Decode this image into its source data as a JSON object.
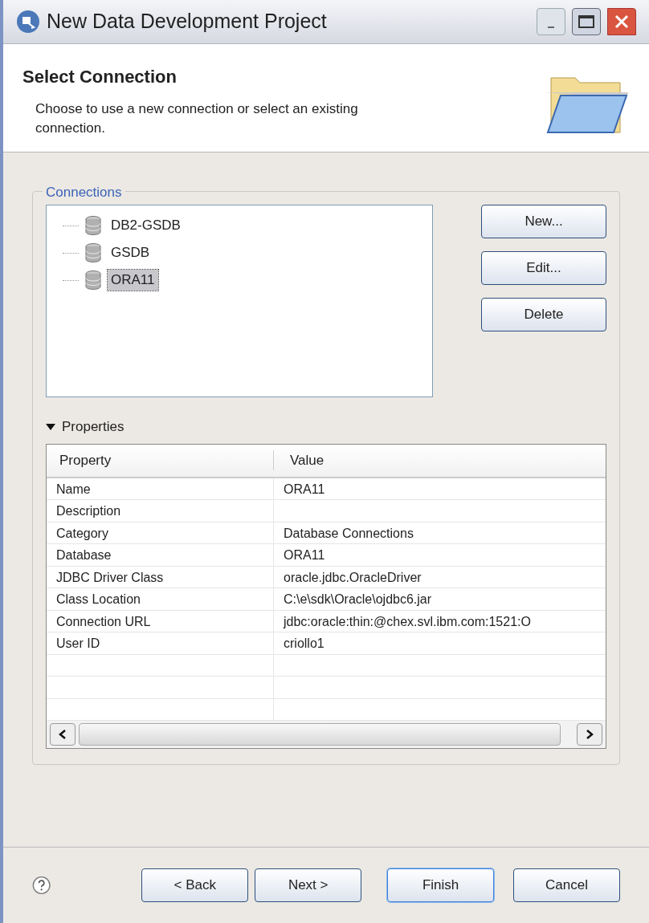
{
  "window": {
    "title": "New Data Development Project"
  },
  "header": {
    "title": "Select Connection",
    "description": "Choose to use a new connection or select an existing connection."
  },
  "connections": {
    "label": "Connections",
    "items": [
      {
        "label": "DB2-GSDB",
        "selected": false
      },
      {
        "label": "GSDB",
        "selected": false
      },
      {
        "label": "ORA11",
        "selected": true
      }
    ],
    "buttons": [
      "New...",
      "Edit...",
      "Delete"
    ]
  },
  "properties": {
    "label": "Properties",
    "expanded": true,
    "columns": [
      "Property",
      "Value"
    ],
    "rows": [
      [
        "Name",
        "ORA11"
      ],
      [
        "Description",
        ""
      ],
      [
        "Category",
        "Database Connections"
      ],
      [
        "Database",
        "ORA11"
      ],
      [
        "JDBC Driver Class",
        "oracle.jdbc.OracleDriver"
      ],
      [
        "Class Location",
        "C:\\e\\sdk\\Oracle\\ojdbc6.jar"
      ],
      [
        "Connection URL",
        "jdbc:oracle:thin:@chex.svl.ibm.com:1521:O"
      ],
      [
        "User ID",
        "criollo1"
      ]
    ]
  },
  "footer": {
    "buttons": [
      {
        "label": "< Back",
        "default": false
      },
      {
        "label": "Next >",
        "default": false
      },
      {
        "label": "Finish",
        "default": true
      },
      {
        "label": "Cancel",
        "default": false
      }
    ]
  }
}
